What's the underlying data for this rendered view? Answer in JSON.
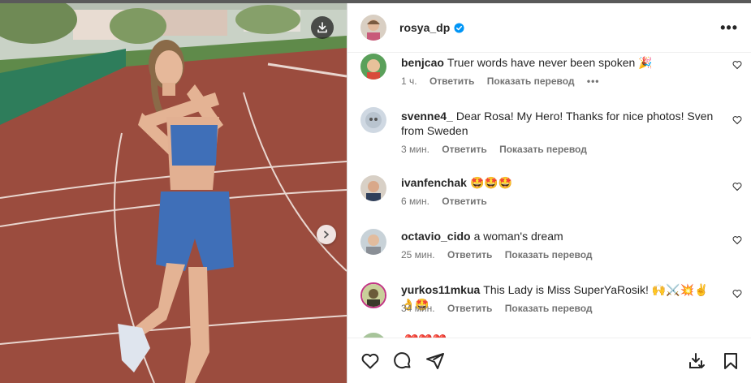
{
  "post": {
    "username": "rosya_dp",
    "more_icon": "more-horizontal-icon"
  },
  "comments": [
    {
      "user": "benjcao",
      "text": "Truer words have never been spoken 🎉",
      "time": "1 ч.",
      "reply": "Ответить",
      "translate": "Показать перевод",
      "has_more": true
    },
    {
      "user": "svenne4_",
      "text": "Dear Rosa! My Hero! Thanks for nice photos! Sven from Sweden",
      "time": "3 мин.",
      "reply": "Ответить",
      "translate": "Показать перевод"
    },
    {
      "user": "ivanfenchak",
      "text": "🤩🤩🤩",
      "time": "6 мин.",
      "reply": "Ответить"
    },
    {
      "user": "octavio_cido",
      "text": "a woman's dream",
      "time": "25 мин.",
      "reply": "Ответить",
      "translate": "Показать перевод"
    },
    {
      "user": "yurkos11mkua",
      "text": "This Lady is Miss SuperYaRosik! 🙌⚔️💥✌️👌🤩",
      "time": "34 мин.",
      "reply": "Ответить",
      "translate": "Показать перевод"
    },
    {
      "user": "",
      "text": "❤️❤️❤️"
    }
  ],
  "footer": {
    "icons": [
      "heart-icon",
      "comment-icon",
      "share-icon",
      "download-icon",
      "bookmark-icon"
    ]
  },
  "colors": {
    "verified": "#0095f6",
    "track": "#9b4c3e",
    "text_secondary": "#737373"
  }
}
